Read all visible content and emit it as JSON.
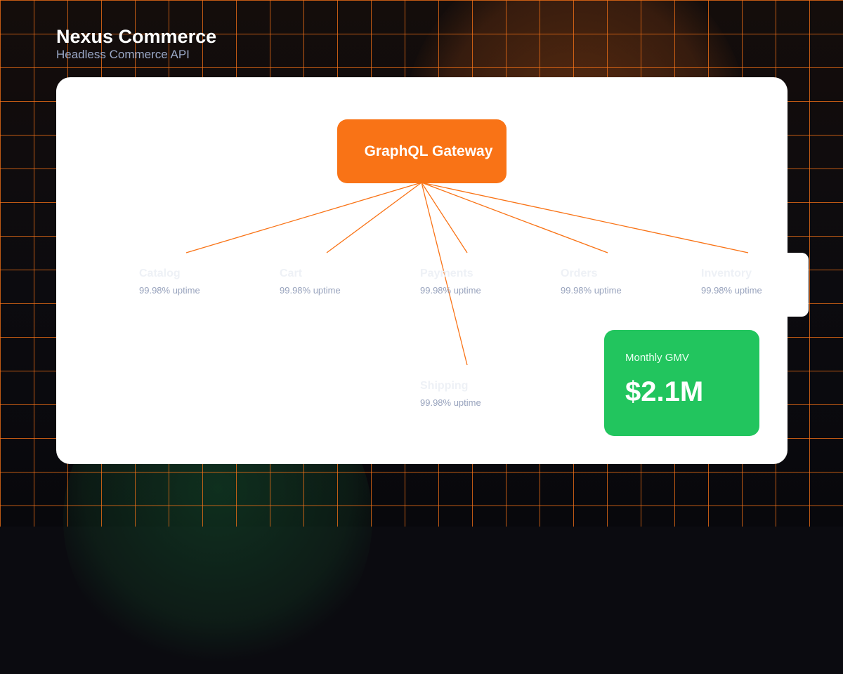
{
  "header": {
    "title": "Nexus Commerce",
    "subtitle": "Headless Commerce API"
  },
  "gateway": {
    "label": "GraphQL Gateway"
  },
  "services": [
    {
      "name": "Catalog",
      "uptime": "99.98% uptime"
    },
    {
      "name": "Cart",
      "uptime": "99.98% uptime"
    },
    {
      "name": "Payments",
      "uptime": "99.98% uptime"
    },
    {
      "name": "Orders",
      "uptime": "99.98% uptime"
    },
    {
      "name": "Inventory",
      "uptime": "99.98% uptime"
    },
    {
      "name": "Shipping",
      "uptime": "99.98% uptime"
    }
  ],
  "metric": {
    "label": "Monthly GMV",
    "value": "$2.1M"
  },
  "colors": {
    "accent": "#f97316",
    "success": "#22c55e",
    "background": "#0b0b10",
    "panel": "#ffffff"
  }
}
